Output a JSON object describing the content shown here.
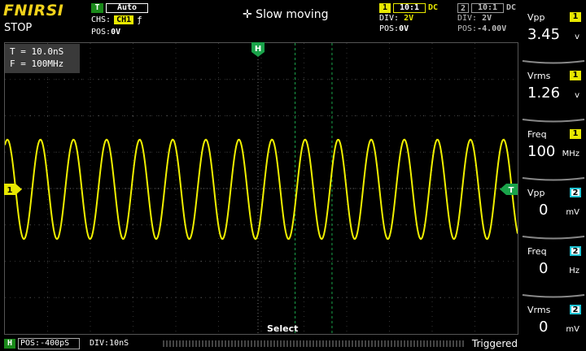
{
  "header": {
    "brand": "FNIRSI",
    "run_state": "STOP",
    "trigger": {
      "tag": "T",
      "mode": "Auto",
      "source_label": "CHS:",
      "source": "CH1",
      "edge_icon": "rising-edge-icon",
      "edge_glyph": "ƒ",
      "pos_label": "POS:",
      "pos": "0V"
    },
    "mode_label": "✛ Slow moving",
    "ch1": {
      "num": "1",
      "probe": "10:1",
      "coupling": "DC",
      "div_label": "DIV:",
      "div": "2V",
      "pos_label": "POS:",
      "pos": "0V",
      "color": "#e8e800"
    },
    "ch2": {
      "num": "2",
      "probe": "10:1",
      "coupling": "DC",
      "div_label": "DIV:",
      "div": "2V",
      "pos_label": "POS:",
      "pos": "-4.00V",
      "color": "#9a9a9a"
    }
  },
  "info": {
    "period": "T = 10.0nS",
    "freq": "F = 100MHz"
  },
  "plot": {
    "h_marker": "H",
    "ch1_marker": "1",
    "trig_marker": "T",
    "select_label": "Select",
    "trace_color": "#f0f000",
    "cursor_color": "#1aa34a",
    "waveform": {
      "cycles_visible": 15.5,
      "amplitude_fraction": 0.9
    }
  },
  "measurements": [
    {
      "title": "Vpp",
      "channel": "1",
      "value": "3.45",
      "unit": "v"
    },
    {
      "title": "Vrms",
      "channel": "1",
      "value": "1.26",
      "unit": "v"
    },
    {
      "title": "Freq",
      "channel": "1",
      "value": "100",
      "unit": "MHz"
    },
    {
      "title": "Vpp",
      "channel": "2",
      "value": "0",
      "unit": "mV"
    },
    {
      "title": "Freq",
      "channel": "2",
      "value": "0",
      "unit": "Hz"
    },
    {
      "title": "Vrms",
      "channel": "2",
      "value": "0",
      "unit": "mV"
    }
  ],
  "footer": {
    "h_tag": "H",
    "pos": "POS:-400pS",
    "div": "DIV:10nS",
    "status": "Triggered"
  }
}
